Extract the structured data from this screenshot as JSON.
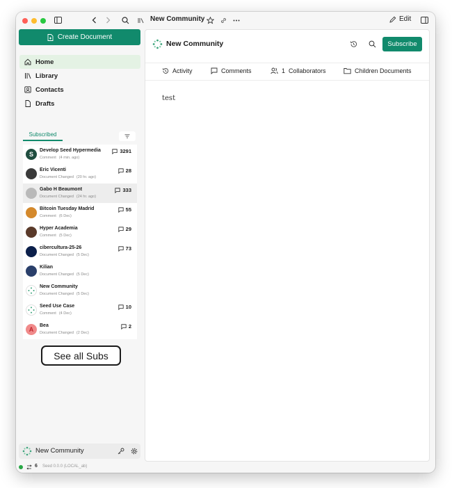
{
  "titlebar": {
    "title": "New Community",
    "edit_label": "Edit"
  },
  "sidebar": {
    "create_label": "Create Document",
    "nav": [
      {
        "label": "Home",
        "icon": "home-icon"
      },
      {
        "label": "Library",
        "icon": "library-icon"
      },
      {
        "label": "Contacts",
        "icon": "contacts-icon"
      },
      {
        "label": "Drafts",
        "icon": "drafts-icon"
      }
    ],
    "subscribed_tab": "Subscribed",
    "subscriptions": [
      {
        "name": "Develop Seed Hypermedia",
        "event": "Comment",
        "time": "(4 min. ago)",
        "count": "3291",
        "avatar_color": "#1f4d3f",
        "avatar_letter": "S"
      },
      {
        "name": "Eric Vicenti",
        "event": "Document Changed",
        "time": "(20 hr. ago)",
        "count": "28",
        "avatar_color": "#3a3a3a",
        "avatar_letter": ""
      },
      {
        "name": "Gabo H Beaumont",
        "event": "Document Changed",
        "time": "(24 hr. ago)",
        "count": "333",
        "avatar_color": "#b9b9b9",
        "avatar_letter": ""
      },
      {
        "name": "Bitcoin Tuesday Madrid",
        "event": "Comment",
        "time": "(6 Dec)",
        "count": "55",
        "avatar_color": "#d4892c",
        "avatar_letter": ""
      },
      {
        "name": "Hyper Academia",
        "event": "Comment",
        "time": "(5 Dec)",
        "count": "29",
        "avatar_color": "#5a3a2a",
        "avatar_letter": ""
      },
      {
        "name": "cibercultura-25-26",
        "event": "Document Changed",
        "time": "(5 Dec)",
        "count": "73",
        "avatar_color": "#0b1f4a",
        "avatar_letter": ""
      },
      {
        "name": "Kilian",
        "event": "Document Changed",
        "time": "(5 Dec)",
        "count": "",
        "avatar_color": "#2a3f6a",
        "avatar_letter": ""
      },
      {
        "name": "New Community",
        "event": "Document Changed",
        "time": "(5 Dec)",
        "count": "",
        "avatar_color": "#ffffff",
        "avatar_letter": ""
      },
      {
        "name": "Seed Use Case",
        "event": "Comment",
        "time": "(4 Dec)",
        "count": "10",
        "avatar_color": "#ffffff",
        "avatar_letter": ""
      },
      {
        "name": "Bea",
        "event": "Document Changed",
        "time": "(2 Dec)",
        "count": "2",
        "avatar_color": "#f08a8a",
        "avatar_letter": "A"
      }
    ],
    "see_all_label": "See all Subs",
    "account_name": "New Community",
    "status": {
      "sync_count": "6",
      "version": "Seed 0.0.0 (LOCAL_ab)"
    }
  },
  "main": {
    "doc_title": "New Community",
    "subscribe_label": "Subscribe",
    "tabs": [
      {
        "label": "Activity",
        "icon": "clock-icon"
      },
      {
        "label": "Comments",
        "icon": "comment-icon"
      },
      {
        "label": "1  Collaborators",
        "icon": "users-icon"
      },
      {
        "label": "Children Documents",
        "icon": "folder-icon"
      }
    ],
    "body": "test"
  },
  "colors": {
    "accent": "#118a6c",
    "active_nav": "#e4f2e4",
    "status_dot": "#28a745"
  }
}
